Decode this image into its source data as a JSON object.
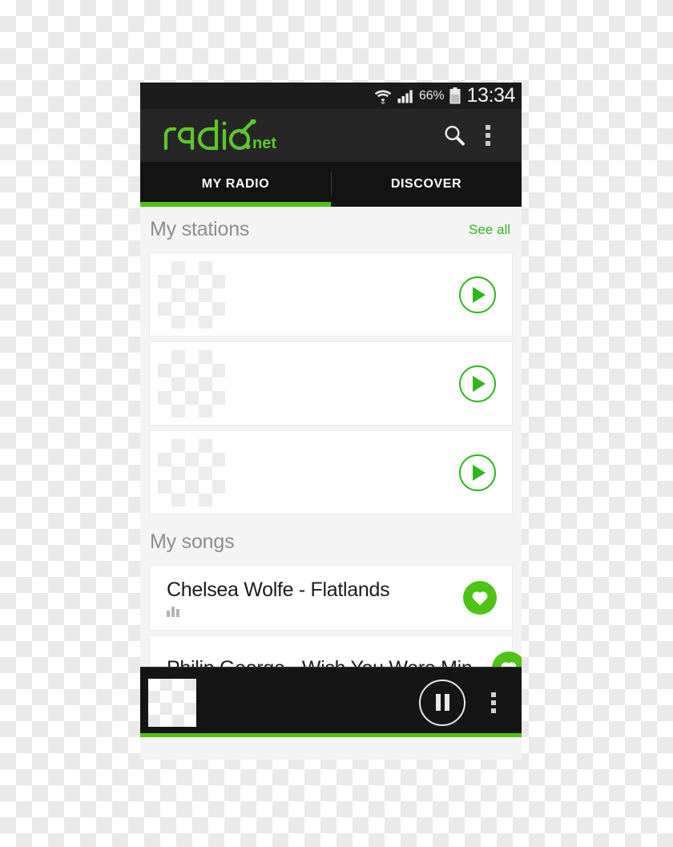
{
  "status_bar": {
    "battery_percent": "66%",
    "clock": "13:34",
    "wifi_icon": "wifi-icon",
    "signal_icon": "cellular-signal-icon",
    "battery_icon": "battery-icon"
  },
  "action_bar": {
    "logo_text": "radio",
    "logo_suffix": ".net",
    "search_icon": "search-icon",
    "overflow_icon": "overflow-menu-icon"
  },
  "tabs": [
    {
      "label": "MY RADIO",
      "active": true
    },
    {
      "label": "DISCOVER",
      "active": false
    }
  ],
  "sections": [
    {
      "title": "My stations",
      "action_label": "See all",
      "items": [
        {
          "thumbnail": "placeholder-image",
          "play_icon": "play-icon"
        },
        {
          "thumbnail": "placeholder-image",
          "play_icon": "play-icon"
        },
        {
          "thumbnail": "placeholder-image",
          "play_icon": "play-icon"
        }
      ]
    },
    {
      "title": "My songs",
      "action_label": "",
      "items": [
        {
          "title": "Chelsea Wolfe - Flatlands",
          "eq_icon": "equalizer-icon",
          "favorite_icon": "heart-icon"
        },
        {
          "title": "Philip George - Wish You Were Min…",
          "eq_icon": "",
          "favorite_icon": "heart-icon"
        }
      ]
    }
  ],
  "player": {
    "thumbnail": "placeholder-image",
    "pause_icon": "pause-icon",
    "overflow_icon": "overflow-menu-icon"
  },
  "colors": {
    "brand_green": "#4fc315",
    "link_green": "#2fb61e",
    "action_bar_bg": "#262626",
    "tab_bar_bg": "#131313",
    "content_bg": "#f4f4f4",
    "player_bg": "#151515"
  }
}
